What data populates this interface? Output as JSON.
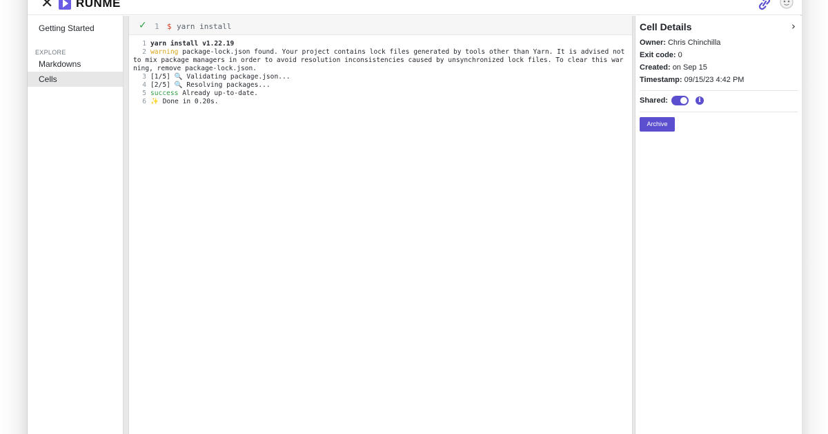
{
  "header": {
    "close_icon": "close-icon",
    "brand": "RUNME",
    "link_icon": "link-icon",
    "avatar_icon": "avatar-icon"
  },
  "sidebar": {
    "items": [
      {
        "label": "Getting Started",
        "active": false
      },
      {
        "label": "Markdowns",
        "active": false
      },
      {
        "label": "Cells",
        "active": true
      }
    ],
    "section_label": "EXPLORE"
  },
  "command": {
    "status_icon": "check-icon",
    "number": "1",
    "prompt": "$",
    "text": "yarn install"
  },
  "output": {
    "lines": [
      {
        "num": "1",
        "prefix": "",
        "text": "yarn install v1.22.19",
        "style": "bold"
      },
      {
        "num": "2",
        "prefix": "warning",
        "text": " package-lock.json found. Your project contains lock files generated by tools other than Yarn. It is advised not to mix package managers in order to avoid resolution inconsistencies caused by unsynchronized lock files. To clear this warning, remove package-lock.json.",
        "style": "warn"
      },
      {
        "num": "3",
        "prefix": "",
        "text": "[1/5] 🔍 Validating package.json...",
        "style": ""
      },
      {
        "num": "4",
        "prefix": "",
        "text": "[2/5] 🔍 Resolving packages...",
        "style": ""
      },
      {
        "num": "5",
        "prefix": "success",
        "text": " Already up-to-date.",
        "style": "succ"
      },
      {
        "num": "6",
        "prefix": "",
        "text": "✨ Done in 0.20s.",
        "style": ""
      }
    ]
  },
  "details": {
    "title": "Cell Details",
    "owner_label": "Owner:",
    "owner": "Chris Chinchilla",
    "exit_label": "Exit code:",
    "exit_code": "0",
    "created_label": "Created:",
    "created": "on Sep 15",
    "timestamp_label": "Timestamp:",
    "timestamp": "09/15/23 4:42 PM",
    "shared_label": "Shared:",
    "shared": true,
    "info_glyph": "i",
    "archive_label": "Archive",
    "accent_color": "#5b4fcf"
  }
}
